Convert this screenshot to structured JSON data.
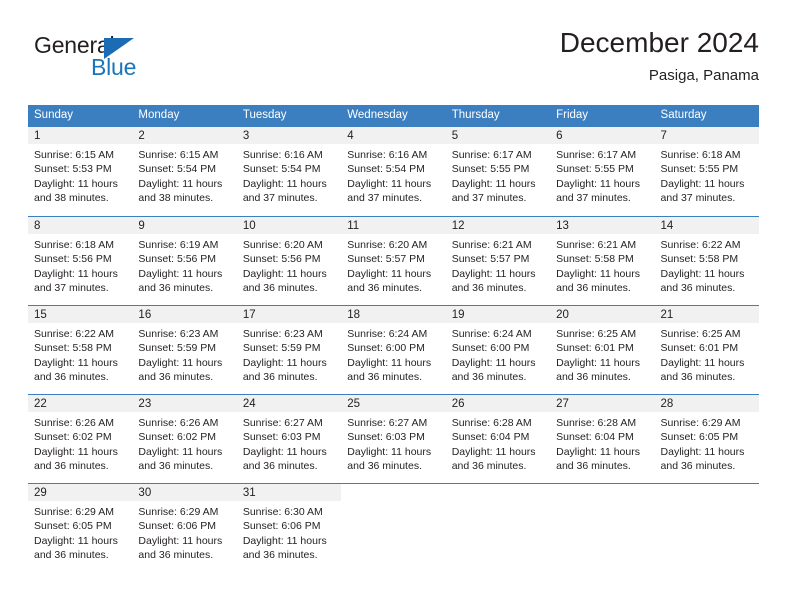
{
  "logo": {
    "word_top": "General",
    "word_bottom": "Blue",
    "triangle_color": "#1b6cb4",
    "blue_color": "#1b75bb"
  },
  "header": {
    "title": "December 2024",
    "subtitle": "Pasiga, Panama"
  },
  "theme": {
    "header_blue": "#3c7fc1",
    "day_band_gray": "#f1f1f1",
    "text_color": "#231f20"
  },
  "weekdays": [
    "Sunday",
    "Monday",
    "Tuesday",
    "Wednesday",
    "Thursday",
    "Friday",
    "Saturday"
  ],
  "weeks": [
    [
      {
        "day": "1",
        "sunrise": "Sunrise: 6:15 AM",
        "sunset": "Sunset: 5:53 PM",
        "daylight_1": "Daylight: 11 hours",
        "daylight_2": "and 38 minutes."
      },
      {
        "day": "2",
        "sunrise": "Sunrise: 6:15 AM",
        "sunset": "Sunset: 5:54 PM",
        "daylight_1": "Daylight: 11 hours",
        "daylight_2": "and 38 minutes."
      },
      {
        "day": "3",
        "sunrise": "Sunrise: 6:16 AM",
        "sunset": "Sunset: 5:54 PM",
        "daylight_1": "Daylight: 11 hours",
        "daylight_2": "and 37 minutes."
      },
      {
        "day": "4",
        "sunrise": "Sunrise: 6:16 AM",
        "sunset": "Sunset: 5:54 PM",
        "daylight_1": "Daylight: 11 hours",
        "daylight_2": "and 37 minutes."
      },
      {
        "day": "5",
        "sunrise": "Sunrise: 6:17 AM",
        "sunset": "Sunset: 5:55 PM",
        "daylight_1": "Daylight: 11 hours",
        "daylight_2": "and 37 minutes."
      },
      {
        "day": "6",
        "sunrise": "Sunrise: 6:17 AM",
        "sunset": "Sunset: 5:55 PM",
        "daylight_1": "Daylight: 11 hours",
        "daylight_2": "and 37 minutes."
      },
      {
        "day": "7",
        "sunrise": "Sunrise: 6:18 AM",
        "sunset": "Sunset: 5:55 PM",
        "daylight_1": "Daylight: 11 hours",
        "daylight_2": "and 37 minutes."
      }
    ],
    [
      {
        "day": "8",
        "sunrise": "Sunrise: 6:18 AM",
        "sunset": "Sunset: 5:56 PM",
        "daylight_1": "Daylight: 11 hours",
        "daylight_2": "and 37 minutes."
      },
      {
        "day": "9",
        "sunrise": "Sunrise: 6:19 AM",
        "sunset": "Sunset: 5:56 PM",
        "daylight_1": "Daylight: 11 hours",
        "daylight_2": "and 36 minutes."
      },
      {
        "day": "10",
        "sunrise": "Sunrise: 6:20 AM",
        "sunset": "Sunset: 5:56 PM",
        "daylight_1": "Daylight: 11 hours",
        "daylight_2": "and 36 minutes."
      },
      {
        "day": "11",
        "sunrise": "Sunrise: 6:20 AM",
        "sunset": "Sunset: 5:57 PM",
        "daylight_1": "Daylight: 11 hours",
        "daylight_2": "and 36 minutes."
      },
      {
        "day": "12",
        "sunrise": "Sunrise: 6:21 AM",
        "sunset": "Sunset: 5:57 PM",
        "daylight_1": "Daylight: 11 hours",
        "daylight_2": "and 36 minutes."
      },
      {
        "day": "13",
        "sunrise": "Sunrise: 6:21 AM",
        "sunset": "Sunset: 5:58 PM",
        "daylight_1": "Daylight: 11 hours",
        "daylight_2": "and 36 minutes."
      },
      {
        "day": "14",
        "sunrise": "Sunrise: 6:22 AM",
        "sunset": "Sunset: 5:58 PM",
        "daylight_1": "Daylight: 11 hours",
        "daylight_2": "and 36 minutes."
      }
    ],
    [
      {
        "day": "15",
        "sunrise": "Sunrise: 6:22 AM",
        "sunset": "Sunset: 5:58 PM",
        "daylight_1": "Daylight: 11 hours",
        "daylight_2": "and 36 minutes."
      },
      {
        "day": "16",
        "sunrise": "Sunrise: 6:23 AM",
        "sunset": "Sunset: 5:59 PM",
        "daylight_1": "Daylight: 11 hours",
        "daylight_2": "and 36 minutes."
      },
      {
        "day": "17",
        "sunrise": "Sunrise: 6:23 AM",
        "sunset": "Sunset: 5:59 PM",
        "daylight_1": "Daylight: 11 hours",
        "daylight_2": "and 36 minutes."
      },
      {
        "day": "18",
        "sunrise": "Sunrise: 6:24 AM",
        "sunset": "Sunset: 6:00 PM",
        "daylight_1": "Daylight: 11 hours",
        "daylight_2": "and 36 minutes."
      },
      {
        "day": "19",
        "sunrise": "Sunrise: 6:24 AM",
        "sunset": "Sunset: 6:00 PM",
        "daylight_1": "Daylight: 11 hours",
        "daylight_2": "and 36 minutes."
      },
      {
        "day": "20",
        "sunrise": "Sunrise: 6:25 AM",
        "sunset": "Sunset: 6:01 PM",
        "daylight_1": "Daylight: 11 hours",
        "daylight_2": "and 36 minutes."
      },
      {
        "day": "21",
        "sunrise": "Sunrise: 6:25 AM",
        "sunset": "Sunset: 6:01 PM",
        "daylight_1": "Daylight: 11 hours",
        "daylight_2": "and 36 minutes."
      }
    ],
    [
      {
        "day": "22",
        "sunrise": "Sunrise: 6:26 AM",
        "sunset": "Sunset: 6:02 PM",
        "daylight_1": "Daylight: 11 hours",
        "daylight_2": "and 36 minutes."
      },
      {
        "day": "23",
        "sunrise": "Sunrise: 6:26 AM",
        "sunset": "Sunset: 6:02 PM",
        "daylight_1": "Daylight: 11 hours",
        "daylight_2": "and 36 minutes."
      },
      {
        "day": "24",
        "sunrise": "Sunrise: 6:27 AM",
        "sunset": "Sunset: 6:03 PM",
        "daylight_1": "Daylight: 11 hours",
        "daylight_2": "and 36 minutes."
      },
      {
        "day": "25",
        "sunrise": "Sunrise: 6:27 AM",
        "sunset": "Sunset: 6:03 PM",
        "daylight_1": "Daylight: 11 hours",
        "daylight_2": "and 36 minutes."
      },
      {
        "day": "26",
        "sunrise": "Sunrise: 6:28 AM",
        "sunset": "Sunset: 6:04 PM",
        "daylight_1": "Daylight: 11 hours",
        "daylight_2": "and 36 minutes."
      },
      {
        "day": "27",
        "sunrise": "Sunrise: 6:28 AM",
        "sunset": "Sunset: 6:04 PM",
        "daylight_1": "Daylight: 11 hours",
        "daylight_2": "and 36 minutes."
      },
      {
        "day": "28",
        "sunrise": "Sunrise: 6:29 AM",
        "sunset": "Sunset: 6:05 PM",
        "daylight_1": "Daylight: 11 hours",
        "daylight_2": "and 36 minutes."
      }
    ],
    [
      {
        "day": "29",
        "sunrise": "Sunrise: 6:29 AM",
        "sunset": "Sunset: 6:05 PM",
        "daylight_1": "Daylight: 11 hours",
        "daylight_2": "and 36 minutes."
      },
      {
        "day": "30",
        "sunrise": "Sunrise: 6:29 AM",
        "sunset": "Sunset: 6:06 PM",
        "daylight_1": "Daylight: 11 hours",
        "daylight_2": "and 36 minutes."
      },
      {
        "day": "31",
        "sunrise": "Sunrise: 6:30 AM",
        "sunset": "Sunset: 6:06 PM",
        "daylight_1": "Daylight: 11 hours",
        "daylight_2": "and 36 minutes."
      },
      {
        "day": "",
        "sunrise": "",
        "sunset": "",
        "daylight_1": "",
        "daylight_2": ""
      },
      {
        "day": "",
        "sunrise": "",
        "sunset": "",
        "daylight_1": "",
        "daylight_2": ""
      },
      {
        "day": "",
        "sunrise": "",
        "sunset": "",
        "daylight_1": "",
        "daylight_2": ""
      },
      {
        "day": "",
        "sunrise": "",
        "sunset": "",
        "daylight_1": "",
        "daylight_2": ""
      }
    ]
  ]
}
